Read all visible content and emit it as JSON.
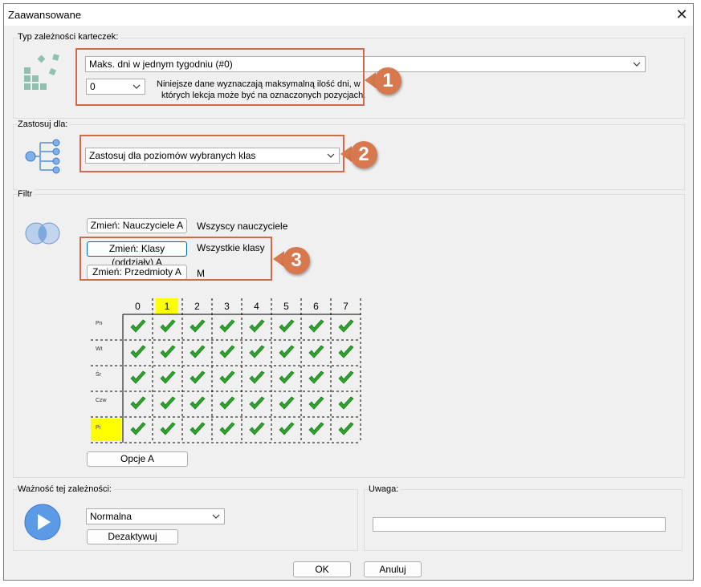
{
  "window": {
    "title": "Zaawansowane",
    "close_label": "✕"
  },
  "type_group": {
    "label": "Typ zależności karteczek:",
    "combo_value": "Maks. dni w jednym tygodniu (#0)",
    "number_value": "0",
    "description_line1": "Niniejsze dane wyznaczają maksymalną ilość dni, w",
    "description_line2": "których lekcja może być na oznaczonych pozycjach.",
    "callout": "1"
  },
  "apply_group": {
    "label": "Zastosuj dla:",
    "combo_value": "Zastosuj dla poziomów wybranych klas",
    "callout": "2"
  },
  "filter_group": {
    "label": "Filtr",
    "teachers_button": "Zmień: Nauczyciele A",
    "teachers_value": "Wszyscy nauczyciele",
    "classes_button": "Zmień: Klasy (oddziały) A",
    "classes_value": "Wszystkie klasy",
    "subjects_button": "Zmień: Przedmioty A",
    "subjects_value": "M",
    "callout": "3",
    "columns": [
      "0",
      "1",
      "2",
      "3",
      "4",
      "5",
      "6",
      "7"
    ],
    "highlight_column": 1,
    "rows": [
      "Pn",
      "Wt",
      "Śr",
      "Czw",
      "Pi"
    ],
    "highlight_row": 4,
    "options_button": "Opcje A",
    "highlight_color": "#ffff00",
    "check_color": "#2ea32e"
  },
  "importance_group": {
    "label": "Ważność tej zależności:",
    "combo_value": "Normalna",
    "deactivate_button": "Dezaktywuj"
  },
  "note_group": {
    "label": "Uwaga:",
    "value": ""
  },
  "footer": {
    "ok_label": "OK",
    "cancel_label": "Anuluj"
  },
  "colors": {
    "accent_red": "#d06a4a",
    "callout_fill": "#d8784e",
    "play_blue": "#4a8fe0"
  }
}
